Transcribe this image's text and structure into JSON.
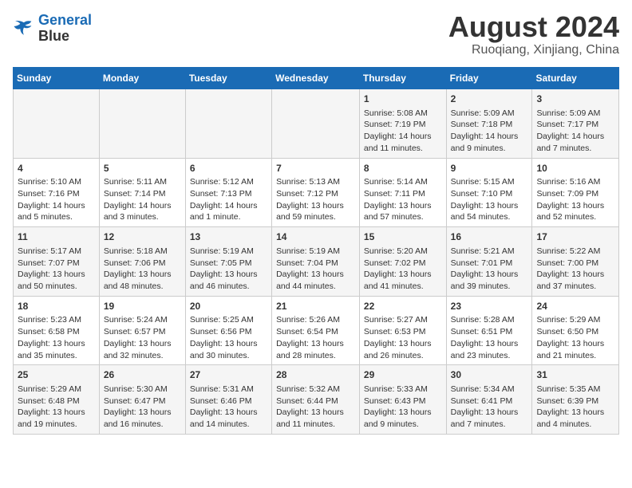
{
  "header": {
    "logo_line1": "General",
    "logo_line2": "Blue",
    "title": "August 2024",
    "subtitle": "Ruoqiang, Xinjiang, China"
  },
  "days_of_week": [
    "Sunday",
    "Monday",
    "Tuesday",
    "Wednesday",
    "Thursday",
    "Friday",
    "Saturday"
  ],
  "weeks": [
    [
      {
        "day": "",
        "text": ""
      },
      {
        "day": "",
        "text": ""
      },
      {
        "day": "",
        "text": ""
      },
      {
        "day": "",
        "text": ""
      },
      {
        "day": "1",
        "text": "Sunrise: 5:08 AM\nSunset: 7:19 PM\nDaylight: 14 hours\nand 11 minutes."
      },
      {
        "day": "2",
        "text": "Sunrise: 5:09 AM\nSunset: 7:18 PM\nDaylight: 14 hours\nand 9 minutes."
      },
      {
        "day": "3",
        "text": "Sunrise: 5:09 AM\nSunset: 7:17 PM\nDaylight: 14 hours\nand 7 minutes."
      }
    ],
    [
      {
        "day": "4",
        "text": "Sunrise: 5:10 AM\nSunset: 7:16 PM\nDaylight: 14 hours\nand 5 minutes."
      },
      {
        "day": "5",
        "text": "Sunrise: 5:11 AM\nSunset: 7:14 PM\nDaylight: 14 hours\nand 3 minutes."
      },
      {
        "day": "6",
        "text": "Sunrise: 5:12 AM\nSunset: 7:13 PM\nDaylight: 14 hours\nand 1 minute."
      },
      {
        "day": "7",
        "text": "Sunrise: 5:13 AM\nSunset: 7:12 PM\nDaylight: 13 hours\nand 59 minutes."
      },
      {
        "day": "8",
        "text": "Sunrise: 5:14 AM\nSunset: 7:11 PM\nDaylight: 13 hours\nand 57 minutes."
      },
      {
        "day": "9",
        "text": "Sunrise: 5:15 AM\nSunset: 7:10 PM\nDaylight: 13 hours\nand 54 minutes."
      },
      {
        "day": "10",
        "text": "Sunrise: 5:16 AM\nSunset: 7:09 PM\nDaylight: 13 hours\nand 52 minutes."
      }
    ],
    [
      {
        "day": "11",
        "text": "Sunrise: 5:17 AM\nSunset: 7:07 PM\nDaylight: 13 hours\nand 50 minutes."
      },
      {
        "day": "12",
        "text": "Sunrise: 5:18 AM\nSunset: 7:06 PM\nDaylight: 13 hours\nand 48 minutes."
      },
      {
        "day": "13",
        "text": "Sunrise: 5:19 AM\nSunset: 7:05 PM\nDaylight: 13 hours\nand 46 minutes."
      },
      {
        "day": "14",
        "text": "Sunrise: 5:19 AM\nSunset: 7:04 PM\nDaylight: 13 hours\nand 44 minutes."
      },
      {
        "day": "15",
        "text": "Sunrise: 5:20 AM\nSunset: 7:02 PM\nDaylight: 13 hours\nand 41 minutes."
      },
      {
        "day": "16",
        "text": "Sunrise: 5:21 AM\nSunset: 7:01 PM\nDaylight: 13 hours\nand 39 minutes."
      },
      {
        "day": "17",
        "text": "Sunrise: 5:22 AM\nSunset: 7:00 PM\nDaylight: 13 hours\nand 37 minutes."
      }
    ],
    [
      {
        "day": "18",
        "text": "Sunrise: 5:23 AM\nSunset: 6:58 PM\nDaylight: 13 hours\nand 35 minutes."
      },
      {
        "day": "19",
        "text": "Sunrise: 5:24 AM\nSunset: 6:57 PM\nDaylight: 13 hours\nand 32 minutes."
      },
      {
        "day": "20",
        "text": "Sunrise: 5:25 AM\nSunset: 6:56 PM\nDaylight: 13 hours\nand 30 minutes."
      },
      {
        "day": "21",
        "text": "Sunrise: 5:26 AM\nSunset: 6:54 PM\nDaylight: 13 hours\nand 28 minutes."
      },
      {
        "day": "22",
        "text": "Sunrise: 5:27 AM\nSunset: 6:53 PM\nDaylight: 13 hours\nand 26 minutes."
      },
      {
        "day": "23",
        "text": "Sunrise: 5:28 AM\nSunset: 6:51 PM\nDaylight: 13 hours\nand 23 minutes."
      },
      {
        "day": "24",
        "text": "Sunrise: 5:29 AM\nSunset: 6:50 PM\nDaylight: 13 hours\nand 21 minutes."
      }
    ],
    [
      {
        "day": "25",
        "text": "Sunrise: 5:29 AM\nSunset: 6:48 PM\nDaylight: 13 hours\nand 19 minutes."
      },
      {
        "day": "26",
        "text": "Sunrise: 5:30 AM\nSunset: 6:47 PM\nDaylight: 13 hours\nand 16 minutes."
      },
      {
        "day": "27",
        "text": "Sunrise: 5:31 AM\nSunset: 6:46 PM\nDaylight: 13 hours\nand 14 minutes."
      },
      {
        "day": "28",
        "text": "Sunrise: 5:32 AM\nSunset: 6:44 PM\nDaylight: 13 hours\nand 11 minutes."
      },
      {
        "day": "29",
        "text": "Sunrise: 5:33 AM\nSunset: 6:43 PM\nDaylight: 13 hours\nand 9 minutes."
      },
      {
        "day": "30",
        "text": "Sunrise: 5:34 AM\nSunset: 6:41 PM\nDaylight: 13 hours\nand 7 minutes."
      },
      {
        "day": "31",
        "text": "Sunrise: 5:35 AM\nSunset: 6:39 PM\nDaylight: 13 hours\nand 4 minutes."
      }
    ]
  ]
}
